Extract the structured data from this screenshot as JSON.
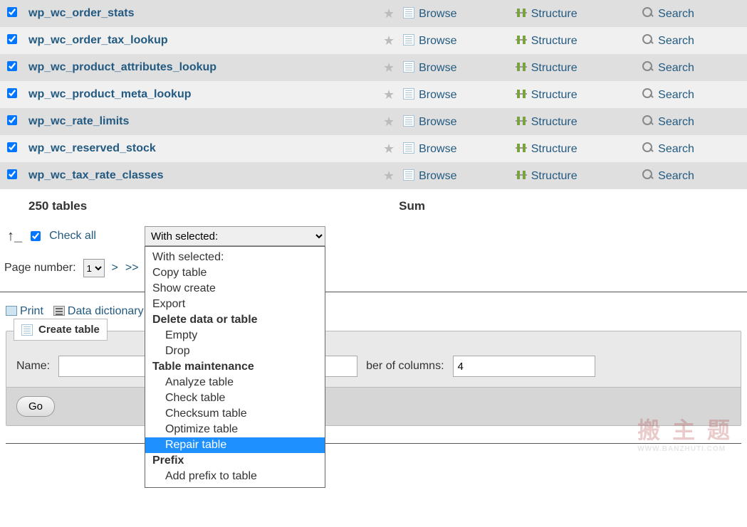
{
  "tables": [
    {
      "name": "wp_wc_order_stats"
    },
    {
      "name": "wp_wc_order_tax_lookup"
    },
    {
      "name": "wp_wc_product_attributes_lookup"
    },
    {
      "name": "wp_wc_product_meta_lookup"
    },
    {
      "name": "wp_wc_rate_limits"
    },
    {
      "name": "wp_wc_reserved_stock"
    },
    {
      "name": "wp_wc_tax_rate_classes"
    }
  ],
  "actions": {
    "browse": "Browse",
    "structure": "Structure",
    "search": "Search"
  },
  "summary": {
    "count_label": "250 tables",
    "sum_label": "Sum"
  },
  "checkall": {
    "label": "Check all",
    "selected_label": "With selected:"
  },
  "dropdown": [
    {
      "label": "With selected:",
      "type": "opt"
    },
    {
      "label": "Copy table",
      "type": "opt"
    },
    {
      "label": "Show create",
      "type": "opt"
    },
    {
      "label": "Export",
      "type": "opt"
    },
    {
      "label": "Delete data or table",
      "type": "hdr"
    },
    {
      "label": "Empty",
      "type": "sub"
    },
    {
      "label": "Drop",
      "type": "sub"
    },
    {
      "label": "Table maintenance",
      "type": "hdr"
    },
    {
      "label": "Analyze table",
      "type": "sub"
    },
    {
      "label": "Check table",
      "type": "sub"
    },
    {
      "label": "Checksum table",
      "type": "sub"
    },
    {
      "label": "Optimize table",
      "type": "sub"
    },
    {
      "label": "Repair table",
      "type": "sub",
      "selected": true
    },
    {
      "label": "Prefix",
      "type": "hdr"
    },
    {
      "label": "Add prefix to table",
      "type": "sub"
    }
  ],
  "pagination": {
    "label": "Page number:",
    "value": "1",
    "next": ">",
    "last": ">>"
  },
  "links": {
    "print": "Print",
    "dict": "Data dictionary"
  },
  "create": {
    "legend": "Create table",
    "name_label": "Name:",
    "cols_label": "ber of columns:",
    "cols_value": "4",
    "go": "Go"
  },
  "watermark": {
    "main": "搬 主 题",
    "sub": "WWW.BANZHUTI.COM"
  }
}
